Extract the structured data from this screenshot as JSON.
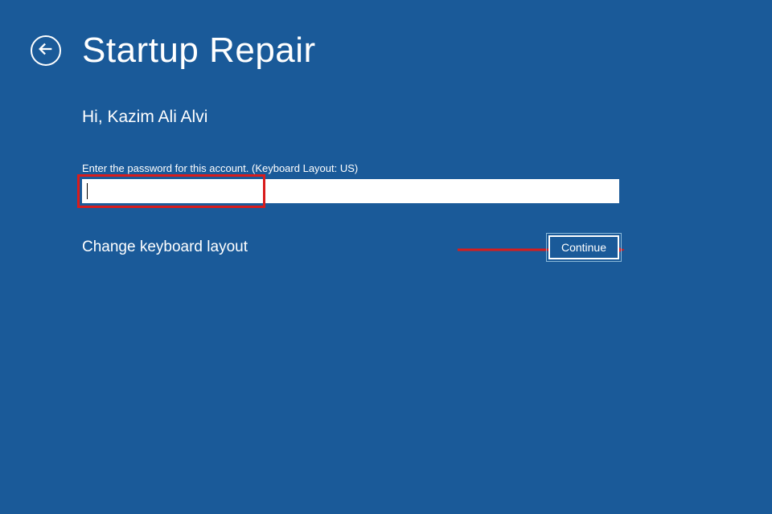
{
  "header": {
    "title": "Startup Repair"
  },
  "content": {
    "greeting": "Hi, Kazim Ali Alvi",
    "prompt": "Enter the password for this account. (Keyboard Layout: US)",
    "password_value": "",
    "change_layout_label": "Change keyboard layout",
    "continue_label": "Continue"
  },
  "colors": {
    "background": "#1a5a99",
    "highlight": "#d91c1c",
    "arrow": "#d91c1c"
  }
}
